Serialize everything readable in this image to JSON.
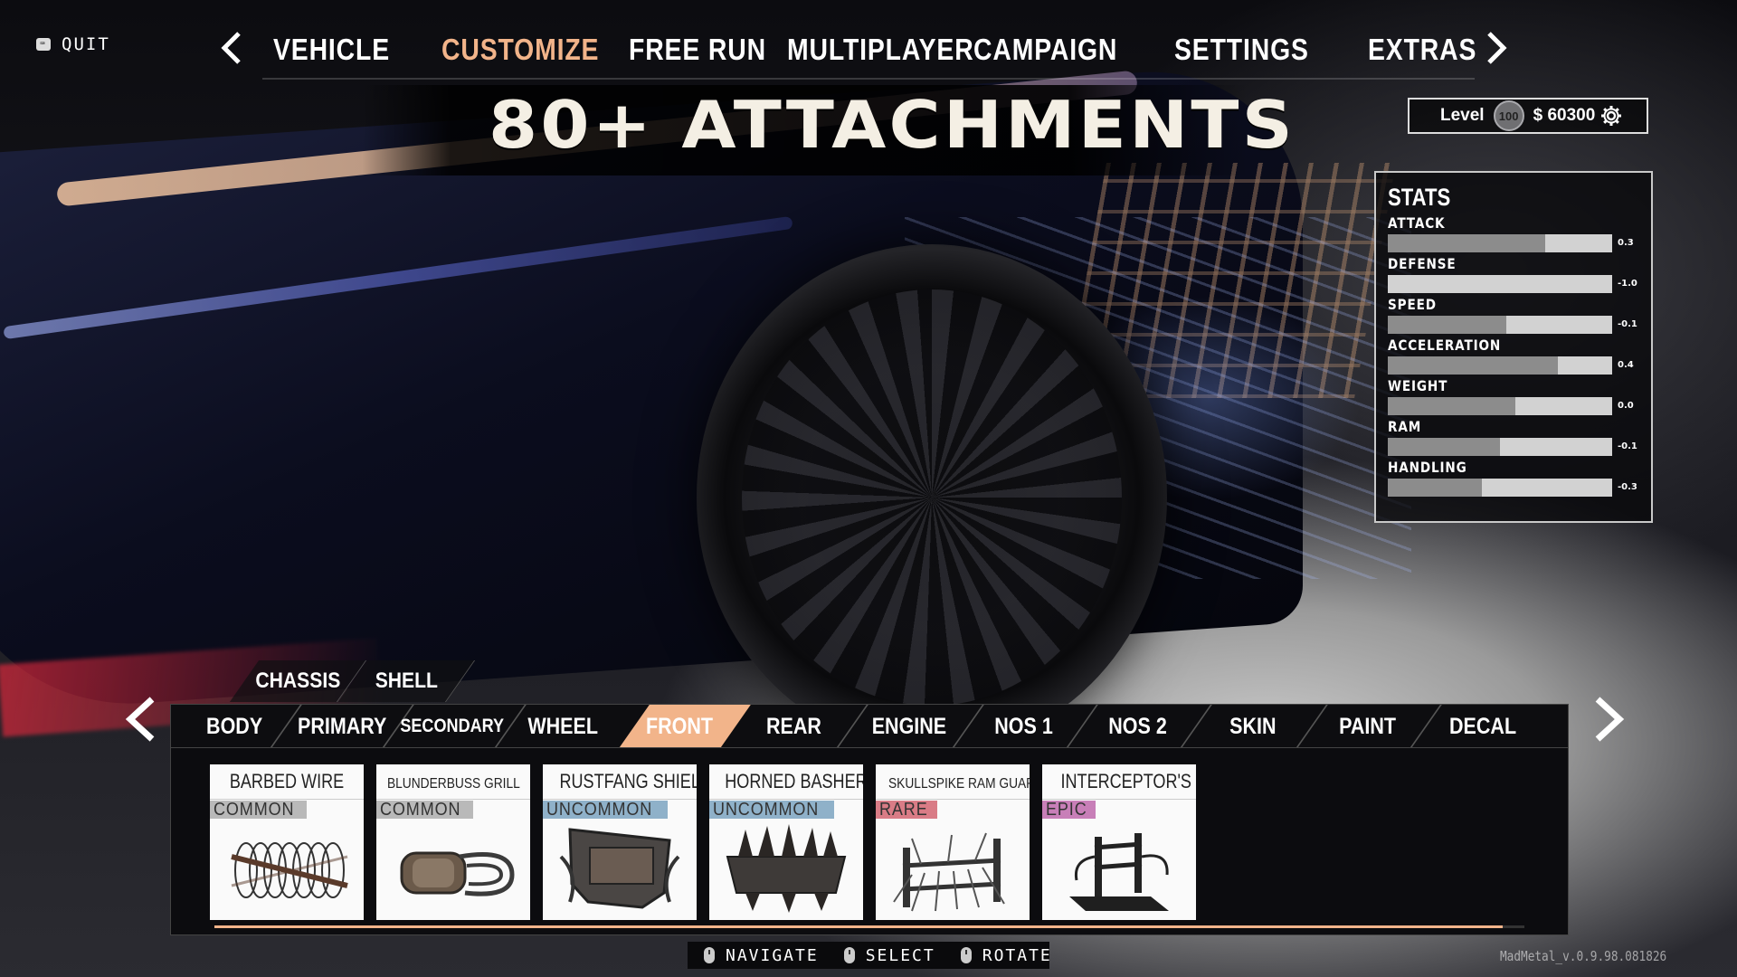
{
  "quit": {
    "key_icon": "keyboard-key-icon",
    "label": "QUIT"
  },
  "top_nav": {
    "tabs": [
      {
        "label": "VEHICLE"
      },
      {
        "label": "CUSTOMIZE"
      },
      {
        "label": "FREE RUN"
      },
      {
        "label": "MULTIPLAYER"
      },
      {
        "label": "CAMPAIGN"
      },
      {
        "label": "SETTINGS"
      },
      {
        "label": "EXTRAS"
      }
    ],
    "active": "CUSTOMIZE",
    "accent_color": "#f2b48a"
  },
  "banner": {
    "text": "80+ ATTACHMENTS"
  },
  "player": {
    "level_label": "Level",
    "level": "100",
    "money": "$ 60300"
  },
  "stats": {
    "title": "STATS",
    "items": [
      {
        "name": "ATTACK",
        "value": "0.3",
        "fill": 0.7
      },
      {
        "name": "DEFENSE",
        "value": "-1.0",
        "fill": 0.0
      },
      {
        "name": "SPEED",
        "value": "-0.1",
        "fill": 0.53
      },
      {
        "name": "ACCELERATION",
        "value": "0.4",
        "fill": 0.76
      },
      {
        "name": "WEIGHT",
        "value": "0.0",
        "fill": 0.57
      },
      {
        "name": "RAM",
        "value": "-0.1",
        "fill": 0.5
      },
      {
        "name": "HANDLING",
        "value": "-0.3",
        "fill": 0.42
      }
    ]
  },
  "subtabs": [
    {
      "label": "CHASSIS"
    },
    {
      "label": "SHELL"
    }
  ],
  "category_tabs": [
    {
      "label": "BODY"
    },
    {
      "label": "PRIMARY"
    },
    {
      "label": "SECONDARY"
    },
    {
      "label": "WHEEL"
    },
    {
      "label": "FRONT"
    },
    {
      "label": "REAR"
    },
    {
      "label": "ENGINE"
    },
    {
      "label": "NOS 1"
    },
    {
      "label": "NOS 2"
    },
    {
      "label": "SKIN"
    },
    {
      "label": "PAINT"
    },
    {
      "label": "DECAL"
    }
  ],
  "active_category": "FRONT",
  "items": [
    {
      "name": "BARBED WIRE",
      "rarity": "COMMON",
      "rarity_color": "#b9b9b9",
      "icon": "barbed-wire-icon"
    },
    {
      "name": "BLUNDERBUSS GRILL",
      "rarity": "COMMON",
      "rarity_color": "#b9b9b9",
      "icon": "blunderbuss-grill-icon"
    },
    {
      "name": "RUSTFANG SHIELD",
      "rarity": "UNCOMMON",
      "rarity_color": "#8fb1c9",
      "icon": "rustfang-shield-icon"
    },
    {
      "name": "HORNED BASHER",
      "rarity": "UNCOMMON",
      "rarity_color": "#8fb1c9",
      "icon": "horned-basher-icon"
    },
    {
      "name": "SKULLSPIKE RAM GUARD",
      "rarity": "RARE",
      "rarity_color": "#d97c86",
      "icon": "skullspike-ram-guard-icon"
    },
    {
      "name": "INTERCEPTOR'S JAW",
      "rarity": "EPIC",
      "rarity_color": "#c87fb8",
      "icon": "interceptors-jaw-icon"
    }
  ],
  "hints": [
    {
      "icon": "mouse-icon",
      "label": "NAVIGATE"
    },
    {
      "icon": "mouse-icon",
      "label": "SELECT"
    },
    {
      "icon": "mouse-icon",
      "label": "ROTATE"
    }
  ],
  "version": "MadMetal_v.0.9.98.081826"
}
